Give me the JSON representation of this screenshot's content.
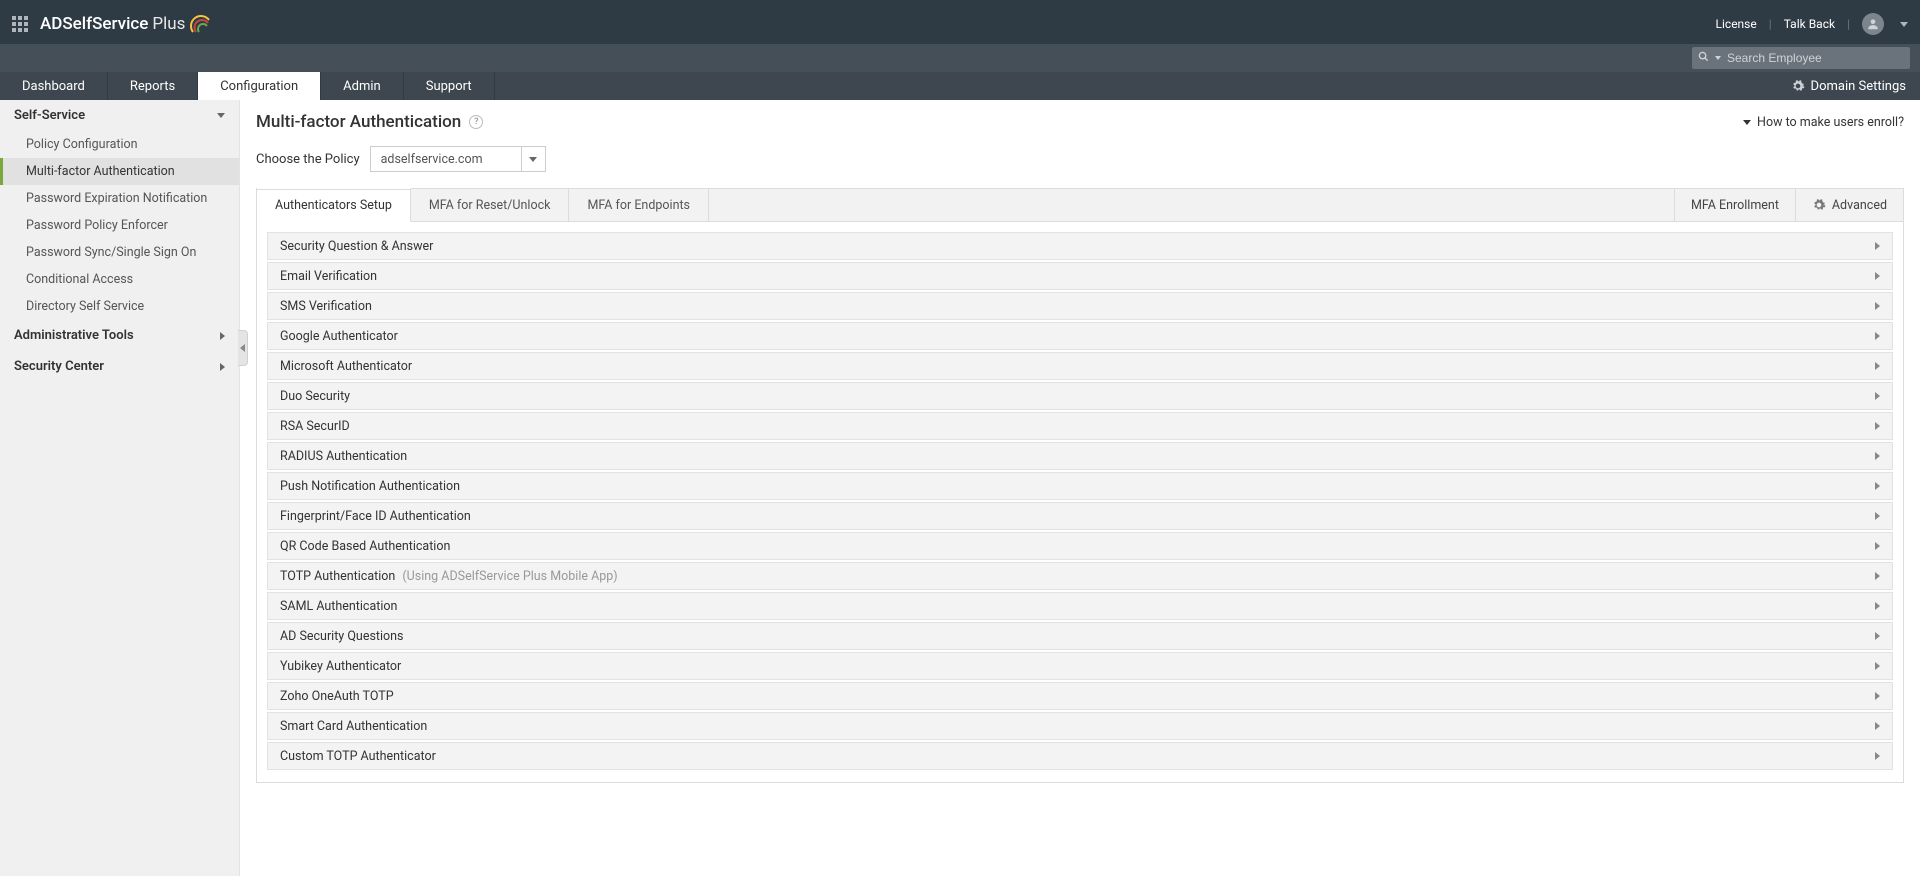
{
  "top": {
    "brand": "ADSelfService",
    "brand_suffix": "Plus",
    "license": "License",
    "talkback": "Talk Back",
    "search_placeholder": "Search Employee"
  },
  "nav": {
    "dashboard": "Dashboard",
    "reports": "Reports",
    "configuration": "Configuration",
    "admin": "Admin",
    "support": "Support",
    "domain_settings": "Domain Settings"
  },
  "sidebar": {
    "self_service": "Self-Service",
    "items": {
      "policy": "Policy Configuration",
      "mfa": "Multi-factor Authentication",
      "pwd_exp": "Password Expiration Notification",
      "pwd_policy": "Password Policy Enforcer",
      "sso": "Password Sync/Single Sign On",
      "cond": "Conditional Access",
      "dir": "Directory Self Service"
    },
    "admin_tools": "Administrative Tools",
    "security_center": "Security Center"
  },
  "page": {
    "title": "Multi-factor Authentication",
    "howto": "How to make users enroll?",
    "choose_policy": "Choose the Policy",
    "policy_value": "adselfservice.com"
  },
  "tabs": {
    "setup": "Authenticators Setup",
    "reset": "MFA for Reset/Unlock",
    "endpoints": "MFA for Endpoints",
    "enrollment": "MFA Enrollment",
    "advanced": "Advanced"
  },
  "auth": {
    "sq": "Security Question & Answer",
    "email": "Email Verification",
    "sms": "SMS Verification",
    "google": "Google Authenticator",
    "ms": "Microsoft Authenticator",
    "duo": "Duo Security",
    "rsa": "RSA SecurID",
    "radius": "RADIUS Authentication",
    "push": "Push Notification Authentication",
    "finger": "Fingerprint/Face ID Authentication",
    "qr": "QR Code Based Authentication",
    "totp": "TOTP Authentication",
    "totp_hint": "(Using ADSelfService Plus Mobile App)",
    "saml": "SAML Authentication",
    "adsq": "AD Security Questions",
    "yubi": "Yubikey Authenticator",
    "zoho": "Zoho OneAuth TOTP",
    "smart": "Smart Card Authentication",
    "ctotp": "Custom TOTP Authenticator"
  }
}
